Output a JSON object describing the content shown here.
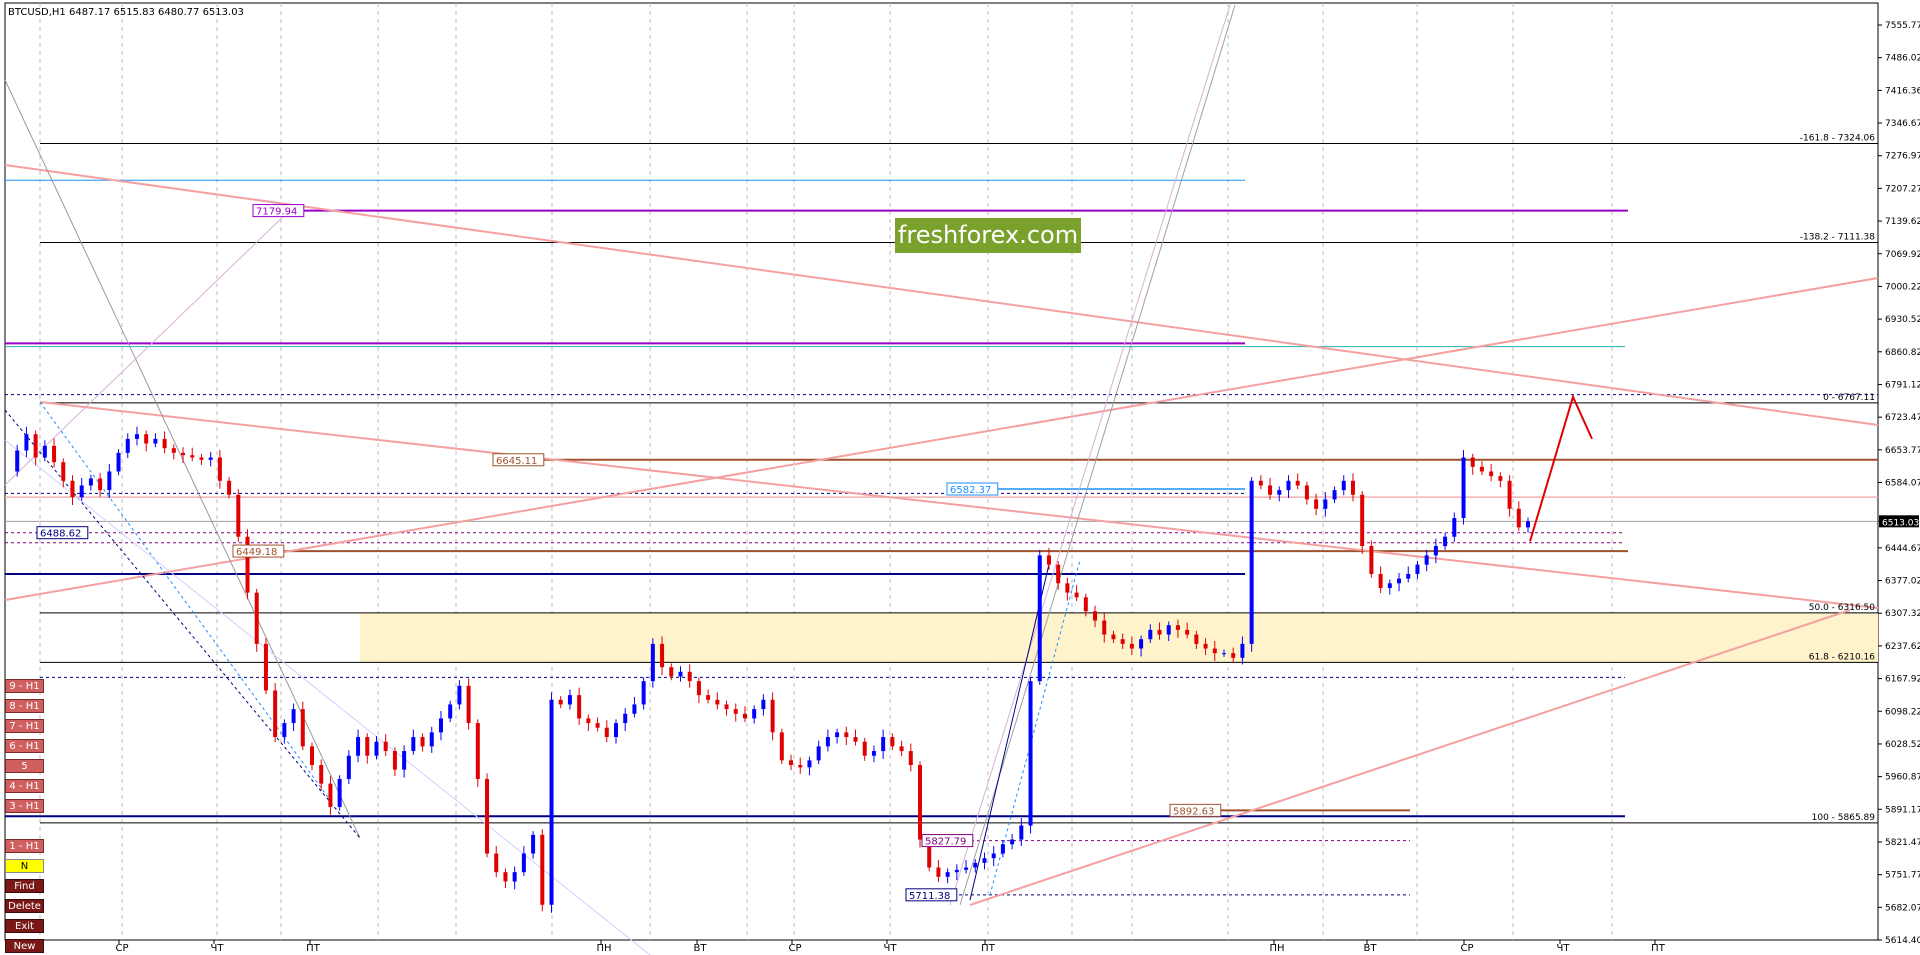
{
  "header": {
    "symbol_line": "BTCUSD,H1  6487.17 6515.83 6480.77 6513.03"
  },
  "brand": {
    "text": "freshforex.com"
  },
  "chart_data": {
    "type": "candlestick",
    "symbol": "BTCUSD",
    "timeframe": "H1",
    "ohlc_header": {
      "open": 6487.17,
      "high": 6515.83,
      "low": 6480.77,
      "close": 6513.03
    },
    "current_price": 6513.03,
    "ylim": [
      5614.4,
      7625.5
    ],
    "price_ticks": [
      "7555.77",
      "7486.02",
      "7416.36",
      "7346.67",
      "7276.97",
      "7207.27",
      "7139.62",
      "7069.92",
      "7000.22",
      "6930.52",
      "6860.82",
      "6791.12",
      "6723.47",
      "6653.77",
      "6584.07",
      "6513.03",
      "6444.67",
      "6377.02",
      "6307.32",
      "6237.62",
      "6167.92",
      "6098.22",
      "6028.52",
      "5960.87",
      "5891.17",
      "5821.47",
      "5751.77",
      "5682.07",
      "5614.40"
    ],
    "time_ticks": [
      "СР",
      "ЧТ",
      "ПТ",
      "ПН",
      "ВТ",
      "СР",
      "ЧТ",
      "ПТ",
      "ПН",
      "ВТ",
      "СР",
      "ЧТ",
      "ПТ"
    ],
    "fib_levels": [
      {
        "label": "-161.8 - 7324.06",
        "price": 7324.06
      },
      {
        "label": "-138.2 - 7111.38",
        "price": 7111.38
      },
      {
        "label": "0 - 6767.11",
        "price": 6767.11
      },
      {
        "label": "50.0 - 6316.50",
        "price": 6316.5
      },
      {
        "label": "61.8 - 6210.16",
        "price": 6210.16
      },
      {
        "label": "100 - 5865.89",
        "price": 5865.89
      }
    ],
    "price_labels": [
      {
        "text": "7179.94",
        "price": 7179.94,
        "color": "#9900cc"
      },
      {
        "text": "6645.11",
        "price": 6645.11,
        "color": "#a0522d"
      },
      {
        "text": "6488.62",
        "price": 6488.62,
        "color": "#000080"
      },
      {
        "text": "6449.18",
        "price": 6449.18,
        "color": "#a0522d"
      },
      {
        "text": "6582.37",
        "price": 6582.37,
        "color": "#1e90ff"
      },
      {
        "text": "5892.63",
        "price": 5892.63,
        "color": "#a0522d"
      },
      {
        "text": "5827.79",
        "price": 5827.79,
        "color": "#800080"
      },
      {
        "text": "5711.38",
        "price": 5711.38,
        "color": "#000080"
      }
    ],
    "zone": {
      "from": 6210.16,
      "to": 6316.5,
      "color": "#fff3cc"
    },
    "projection_path_prices": [
      6470,
      6780,
      6690
    ],
    "close_path": [
      6620,
      6665,
      6700,
      6650,
      6675,
      6640,
      6600,
      6565,
      6590,
      6605,
      6580,
      6620,
      6660,
      6690,
      6700,
      6680,
      6690,
      6670,
      6660,
      6655,
      6650,
      6645,
      6650,
      6600,
      6570,
      6480,
      6360,
      6250,
      6150,
      6050,
      6080,
      6110,
      6030,
      5990,
      5950,
      5900,
      5960,
      6010,
      6050,
      6010,
      6040,
      6020,
      5980,
      6020,
      6050,
      6030,
      6060,
      6090,
      6120,
      6160,
      6080,
      5960,
      5800,
      5760,
      5740,
      5760,
      5800,
      5840,
      5690,
      6130,
      6120,
      6140,
      6090,
      6080,
      6070,
      6050,
      6080,
      6100,
      6120,
      6170,
      6250,
      6200,
      6180,
      6190,
      6170,
      6140,
      6130,
      6120,
      6110,
      6100,
      6090,
      6110,
      6130,
      6060,
      6000,
      5990,
      5985,
      6000,
      6030,
      6050,
      6060,
      6050,
      6040,
      6010,
      6020,
      6050,
      6030,
      6020,
      5990,
      5830,
      5770,
      5750,
      5760,
      5765,
      5770,
      5780,
      5790,
      5800,
      5820,
      5830,
      5860,
      6170,
      6440,
      6420,
      6380,
      6360,
      6350,
      6320,
      6300,
      6270,
      6260,
      6250,
      6240,
      6260,
      6280,
      6270,
      6290,
      6280,
      6270,
      6250,
      6240,
      6230,
      6230,
      6220,
      6250,
      6600,
      6590,
      6570,
      6580,
      6600,
      6590,
      6560,
      6540,
      6560,
      6580,
      6600,
      6570,
      6460,
      6400,
      6370,
      6380,
      6390,
      6400,
      6420,
      6440,
      6460,
      6480,
      6520,
      6650,
      6630,
      6620,
      6610,
      6600,
      6540,
      6500,
      6513
    ]
  },
  "side_buttons": [
    {
      "label": "9 - H1",
      "style": "red"
    },
    {
      "label": "8 - H1",
      "style": "red"
    },
    {
      "label": "7 - H1",
      "style": "red"
    },
    {
      "label": "6 - H1",
      "style": "red"
    },
    {
      "label": "5",
      "style": "red"
    },
    {
      "label": "4 - H1",
      "style": "red"
    },
    {
      "label": "3 - H1",
      "style": "red"
    },
    {
      "label": "1 - H1",
      "style": "red"
    },
    {
      "label": "N",
      "style": "yellow"
    },
    {
      "label": "Find",
      "style": "grey"
    },
    {
      "label": "Delete",
      "style": "grey"
    },
    {
      "label": "Exit",
      "style": "grey"
    },
    {
      "label": "New",
      "style": "grey"
    }
  ]
}
